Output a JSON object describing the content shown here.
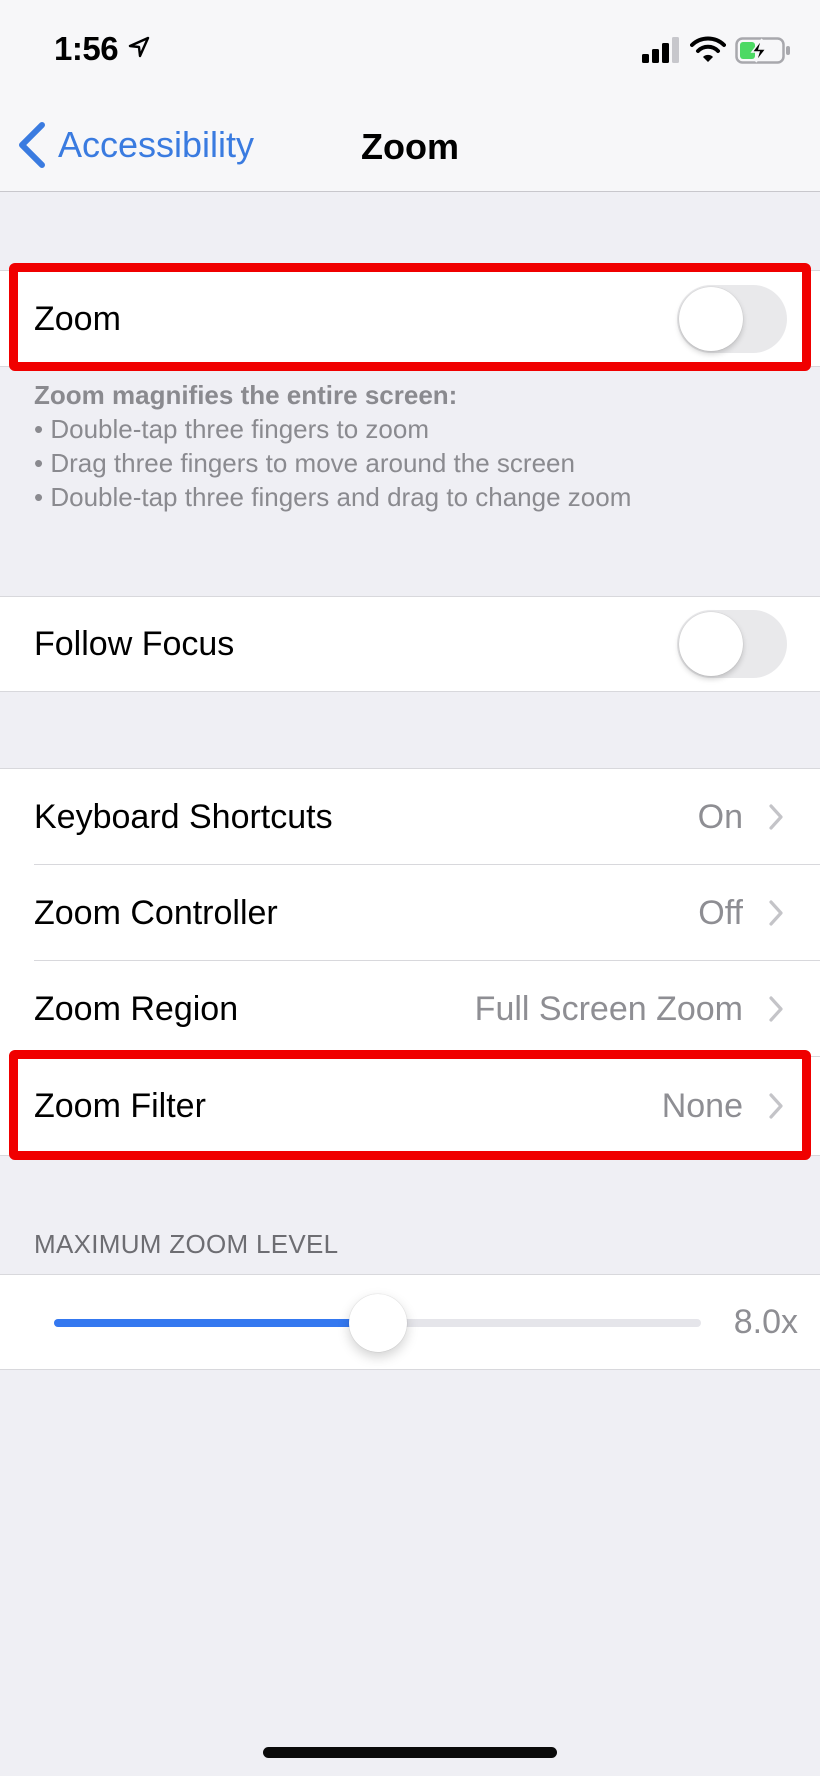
{
  "status_bar": {
    "time": "1:56",
    "icons": [
      "location-arrow-icon",
      "cellular-signal-icon",
      "wifi-icon",
      "battery-charging-icon"
    ],
    "battery_color": "#4cd964"
  },
  "nav": {
    "back_label": "Accessibility",
    "title": "Zoom",
    "accent_color": "#3a7be0"
  },
  "zoom_group": {
    "label": "Zoom",
    "toggle_on": false
  },
  "zoom_footer": {
    "title": "Zoom magnifies the entire screen:",
    "bullets": [
      "• Double-tap three fingers to zoom",
      "• Drag three fingers to move around the screen",
      "• Double-tap three fingers and drag to change zoom"
    ]
  },
  "follow_focus": {
    "label": "Follow Focus",
    "toggle_on": false
  },
  "settings_rows": [
    {
      "label": "Keyboard Shortcuts",
      "value": "On"
    },
    {
      "label": "Zoom Controller",
      "value": "Off"
    },
    {
      "label": "Zoom Region",
      "value": "Full Screen Zoom"
    },
    {
      "label": "Zoom Filter",
      "value": "None"
    }
  ],
  "max_zoom": {
    "header": "MAXIMUM ZOOM LEVEL",
    "value_label": "8.0x",
    "value": 8.0,
    "min": 1.0,
    "max": 15.0,
    "fill_color": "#3478f0"
  },
  "annotations": {
    "highlight_color": "#f00000",
    "highlighted": [
      "Zoom",
      "Zoom Filter"
    ]
  }
}
